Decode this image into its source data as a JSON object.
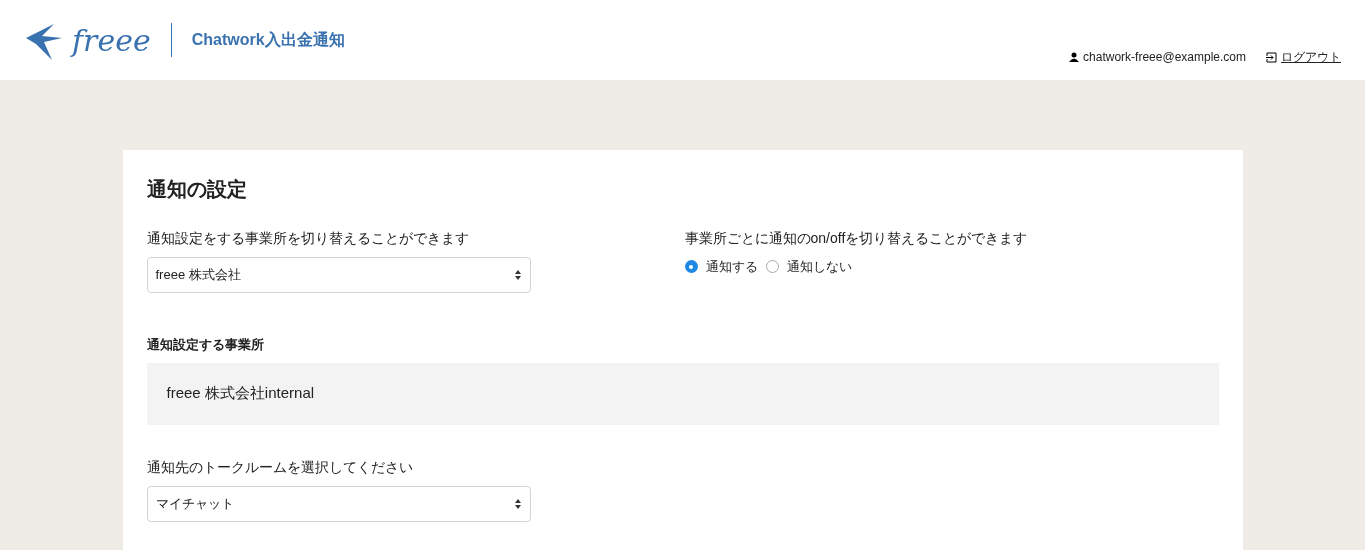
{
  "header": {
    "logo_text": "freee",
    "app_title": "Chatwork入出金通知",
    "user_email": "chatwork-freee@example.com",
    "logout_link": "ログアウト"
  },
  "settings": {
    "title": "通知の設定",
    "office_select": {
      "label": "通知設定をする事業所を切り替えることができます",
      "value": "freee 株式会社"
    },
    "notify_toggle": {
      "label": "事業所ごとに通知のon/offを切り替えることができます",
      "options": [
        {
          "label": "通知する",
          "selected": true
        },
        {
          "label": "通知しない",
          "selected": false
        }
      ]
    },
    "office_display": {
      "label": "通知設定する事業所",
      "value": "freee 株式会社internal"
    },
    "room_select": {
      "label": "通知先のトークルームを選択してください",
      "value": "マイチャット"
    }
  }
}
